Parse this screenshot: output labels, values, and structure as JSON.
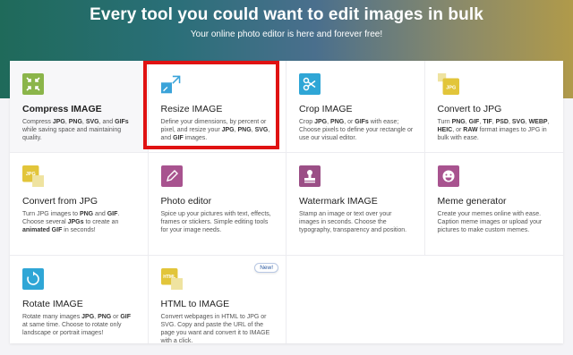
{
  "hero": {
    "title": "Every tool you could want to edit images in bulk",
    "subtitle": "Your online photo editor is here and forever free!"
  },
  "tools": [
    {
      "name": "compress",
      "title": "Compress IMAGE",
      "icon": "compress-icon",
      "color": "#8bb54a",
      "desc_html": "Compress <b>JPG</b>, <b>PNG</b>, <b>SVG</b>, and <b>GIFs</b> while saving space and maintaining quality."
    },
    {
      "name": "resize",
      "title": "Resize IMAGE",
      "icon": "resize-icon",
      "color": "#3aa3d9",
      "desc_html": "Define your dimensions, by percent or pixel, and resize your <b>JPG</b>, <b>PNG</b>, <b>SVG</b>, and <b>GIF</b> images."
    },
    {
      "name": "crop",
      "title": "Crop IMAGE",
      "icon": "scissors-icon",
      "color": "#2fa6d6",
      "desc_html": "Crop <b>JPG</b>, <b>PNG</b>, or <b>GIFs</b> with ease; Choose pixels to define your rectangle or use our visual editor."
    },
    {
      "name": "convert-to-jpg",
      "title": "Convert to JPG",
      "icon": "jpg-icon",
      "color": "#e2c53a",
      "desc_html": "Turn <b>PNG</b>, <b>GIF</b>, <b>TIF</b>, <b>PSD</b>, <b>SVG</b>, <b>WEBP</b>, <b>HEIC</b>, or <b>RAW</b> format images to JPG in bulk with ease."
    },
    {
      "name": "convert-from-jpg",
      "title": "Convert from JPG",
      "icon": "jpg-convert-icon",
      "color": "#e2c53a",
      "desc_html": "Turn JPG images to <b>PNG</b> and <b>GIF</b>. Choose several <b>JPGs</b> to create an <b>animated GIF</b> in seconds!"
    },
    {
      "name": "photo-editor",
      "title": "Photo editor",
      "icon": "pencil-icon",
      "color": "#a8538f",
      "desc_html": "Spice up your pictures with text, effects, frames or stickers. Simple editing tools for your image needs."
    },
    {
      "name": "watermark",
      "title": "Watermark IMAGE",
      "icon": "stamp-icon",
      "color": "#9b4f86",
      "desc_html": "Stamp an image or text over your images in seconds. Choose the typography, transparency and position."
    },
    {
      "name": "meme",
      "title": "Meme generator",
      "icon": "smile-icon",
      "color": "#a8538f",
      "desc_html": "Create your memes online with ease. Caption meme images or upload your pictures to make custom memes."
    },
    {
      "name": "rotate",
      "title": "Rotate IMAGE",
      "icon": "rotate-icon",
      "color": "#2fa6d6",
      "desc_html": "Rotate many images <b>JPG</b>, <b>PNG</b> or <b>GIF</b> at same time. Choose to rotate only landscape or portrait images!"
    },
    {
      "name": "html-to-image",
      "title": "HTML to IMAGE",
      "icon": "html-icon",
      "color": "#e2c53a",
      "badge": "New!",
      "desc_html": "Convert webpages in HTML to JPG or SVG. Copy and paste the URL of the page you want and convert it to IMAGE with a click."
    }
  ]
}
